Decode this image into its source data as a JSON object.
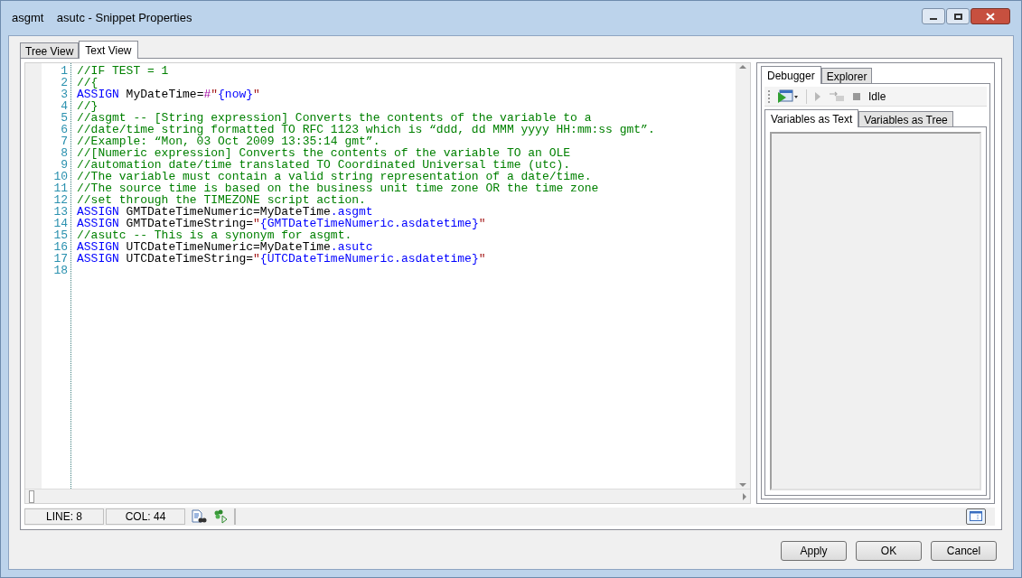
{
  "window": {
    "title": "asgmt    asutc - Snippet Properties"
  },
  "tabs": [
    {
      "label": "Tree View",
      "selected": false
    },
    {
      "label": "Text View",
      "selected": true
    }
  ],
  "editor": {
    "lines": [
      {
        "number": "1",
        "segments": [
          {
            "kind": "comment",
            "text": "//IF TEST = 1"
          }
        ]
      },
      {
        "number": "2",
        "segments": [
          {
            "kind": "comment",
            "text": "//{"
          }
        ]
      },
      {
        "number": "3",
        "segments": [
          {
            "kind": "keyword",
            "text": "ASSIGN"
          },
          {
            "kind": "plain",
            "text": " MyDateTime="
          },
          {
            "kind": "operator",
            "text": "#"
          },
          {
            "kind": "string",
            "text": "\""
          },
          {
            "kind": "member",
            "text": "{now}"
          },
          {
            "kind": "string",
            "text": "\""
          }
        ]
      },
      {
        "number": "4",
        "segments": [
          {
            "kind": "comment",
            "text": "//}"
          }
        ]
      },
      {
        "number": "5",
        "segments": [
          {
            "kind": "comment",
            "text": "//asgmt -- [String expression] Converts the contents of the variable to a"
          }
        ]
      },
      {
        "number": "6",
        "segments": [
          {
            "kind": "comment",
            "text": "//date/time string formatted TO RFC 1123 which is “ddd, dd MMM yyyy HH:mm:ss gmt”."
          }
        ]
      },
      {
        "number": "7",
        "segments": [
          {
            "kind": "comment",
            "text": "//Example: “Mon, 03 Oct 2009 13:35:14 gmt”."
          }
        ]
      },
      {
        "number": "8",
        "segments": [
          {
            "kind": "comment",
            "text": "//[Numeric expression] Converts the contents of the variable TO an OLE"
          }
        ]
      },
      {
        "number": "9",
        "segments": [
          {
            "kind": "comment",
            "text": "//automation date/time translated TO Coordinated Universal time (utc)."
          }
        ]
      },
      {
        "number": "10",
        "segments": [
          {
            "kind": "comment",
            "text": "//The variable must contain a valid string representation of a date/time."
          }
        ]
      },
      {
        "number": "11",
        "segments": [
          {
            "kind": "comment",
            "text": "//The source time is based on the business unit time zone OR the time zone"
          }
        ]
      },
      {
        "number": "12",
        "segments": [
          {
            "kind": "comment",
            "text": "//set through the TIMEZONE script action."
          }
        ]
      },
      {
        "number": "13",
        "segments": [
          {
            "kind": "keyword",
            "text": "ASSIGN"
          },
          {
            "kind": "plain",
            "text": " GMTDateTimeNumeric=MyDateTime"
          },
          {
            "kind": "member",
            "text": ".asgmt"
          }
        ]
      },
      {
        "number": "14",
        "segments": [
          {
            "kind": "keyword",
            "text": "ASSIGN"
          },
          {
            "kind": "plain",
            "text": " GMTDateTimeString="
          },
          {
            "kind": "string",
            "text": "\""
          },
          {
            "kind": "member",
            "text": "{GMTDateTimeNumeric.asdatetime}"
          },
          {
            "kind": "string",
            "text": "\""
          }
        ]
      },
      {
        "number": "15",
        "segments": [
          {
            "kind": "comment",
            "text": "//asutc -- This is a synonym for asgmt."
          }
        ]
      },
      {
        "number": "16",
        "segments": [
          {
            "kind": "keyword",
            "text": "ASSIGN"
          },
          {
            "kind": "plain",
            "text": " UTCDateTimeNumeric=MyDateTime"
          },
          {
            "kind": "member",
            "text": ".asutc"
          }
        ]
      },
      {
        "number": "17",
        "segments": [
          {
            "kind": "keyword",
            "text": "ASSIGN"
          },
          {
            "kind": "plain",
            "text": " UTCDateTimeString="
          },
          {
            "kind": "string",
            "text": "\""
          },
          {
            "kind": "member",
            "text": "{UTCDateTimeNumeric.asdatetime}"
          },
          {
            "kind": "string",
            "text": "\""
          }
        ]
      },
      {
        "number": "18"
      }
    ]
  },
  "status_bar": {
    "line": "LINE: 8",
    "col": "COL: 44"
  },
  "side_panel": {
    "tabs": [
      {
        "label": "Debugger",
        "selected": true
      },
      {
        "label": "Explorer",
        "selected": false
      }
    ],
    "status": "Idle",
    "variable_tabs": [
      {
        "label": "Variables as Text",
        "selected": true
      },
      {
        "label": "Variables as Tree",
        "selected": false
      }
    ]
  },
  "buttons": [
    "Apply",
    "OK",
    "Cancel"
  ]
}
